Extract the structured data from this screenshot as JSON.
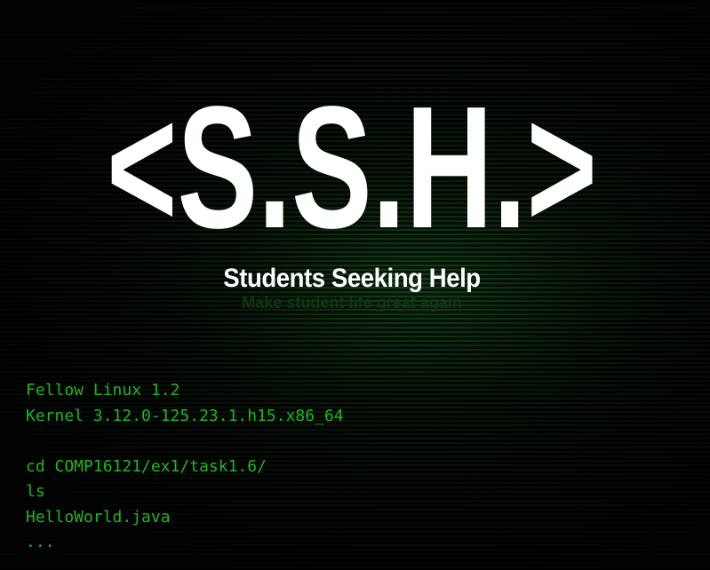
{
  "logo": {
    "text": "<S.S.H.>"
  },
  "tagline": {
    "title": "Students Seeking Help",
    "motto": "Make student life great again"
  },
  "terminal": {
    "os_line": "Fellow Linux 1.2",
    "kernel_line": "Kernel 3.12.0-125.23.1.h15.x86_64",
    "commands": [
      "cd COMP16121/ex1/task1.6/",
      "ls",
      "HelloWorld.java",
      "..."
    ]
  },
  "colors": {
    "terminal_text": "#22b520",
    "logo_text": "#ffffff",
    "motto_text": "#10360f",
    "background": "#030503"
  }
}
